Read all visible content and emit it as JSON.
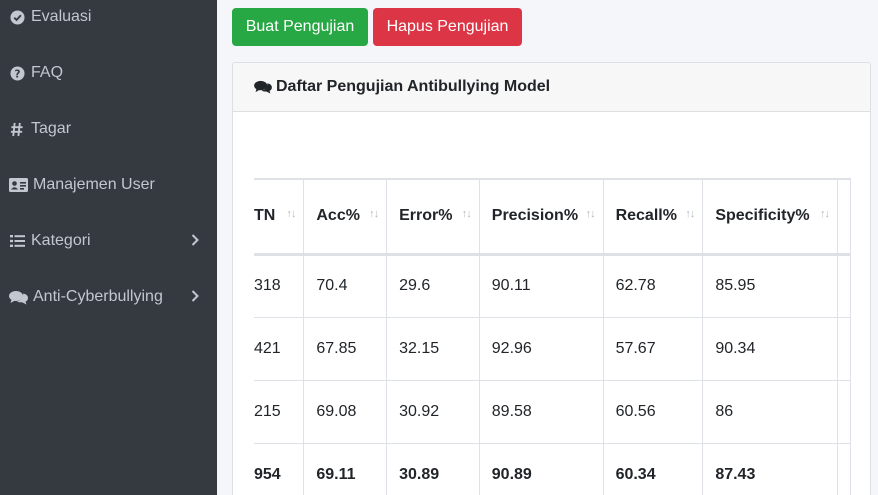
{
  "sidebar": {
    "items": [
      {
        "label": "Evaluasi",
        "icon": "check-circle-icon"
      },
      {
        "label": "FAQ",
        "icon": "question-circle-icon"
      },
      {
        "label": "Tagar",
        "icon": "hashtag-icon"
      },
      {
        "label": "Manajemen User",
        "icon": "id-card-icon"
      },
      {
        "label": "Kategori",
        "icon": "list-icon",
        "has_submenu": true
      },
      {
        "label": "Anti-Cyberbullying",
        "icon": "comments-icon",
        "has_submenu": true
      }
    ]
  },
  "toolbar": {
    "create_label": "Buat Pengujian",
    "delete_label": "Hapus Pengujian"
  },
  "card": {
    "title": "Daftar Pengujian Antibullying Model"
  },
  "table": {
    "columns": [
      "TN",
      "Acc%",
      "Error%",
      "Precision%",
      "Recall%",
      "Specificity%"
    ],
    "rows": [
      [
        "318",
        "70.4",
        "29.6",
        "90.11",
        "62.78",
        "85.95"
      ],
      [
        "421",
        "67.85",
        "32.15",
        "92.96",
        "57.67",
        "90.34"
      ],
      [
        "215",
        "69.08",
        "30.92",
        "89.58",
        "60.56",
        "86"
      ],
      [
        "954",
        "69.11",
        "30.89",
        "90.89",
        "60.34",
        "87.43"
      ]
    ]
  },
  "colors": {
    "sidebar_bg": "#343a40",
    "sidebar_text": "#c2c7d0",
    "success": "#28a745",
    "danger": "#dc3545"
  }
}
